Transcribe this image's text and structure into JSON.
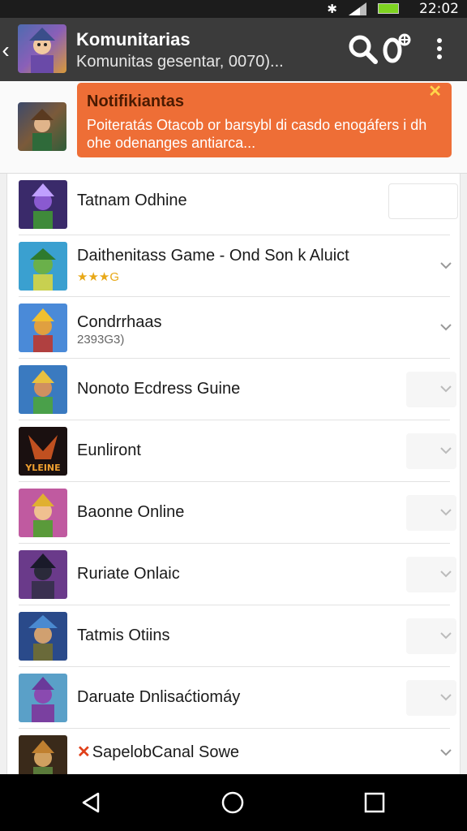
{
  "status": {
    "time": "22:02"
  },
  "app_bar": {
    "title": "Komunitarias",
    "subtitle": "Komunitas gesentar, 0070)...",
    "icons": [
      "back-arrow-icon",
      "search-icon",
      "settings-gear-icon",
      "more-vert-icon"
    ]
  },
  "notification": {
    "title": "Notifikiantas",
    "body": "Poiteratás Otacob or barsybl di casdo enogáfers i dh ohe odenanges antiarca..."
  },
  "games": [
    {
      "name": "Tatnam Odhine",
      "sub": "",
      "control": "button"
    },
    {
      "name": "Daithenitass Game - Ond Son k Aluict",
      "sub": "★★★G",
      "sub_type": "stars",
      "control": "chevron"
    },
    {
      "name": "Condrrhaas",
      "sub": "2393G3)",
      "sub_type": "text",
      "control": "chevron"
    },
    {
      "name": "Nonoto Ecdress Guine",
      "sub": "",
      "control": "chevron"
    },
    {
      "name": "Eunliront",
      "sub": "",
      "control": "chevron"
    },
    {
      "name": "Baonne Online",
      "sub": "",
      "control": "chevron"
    },
    {
      "name": "Ruriate Onlaic",
      "sub": "",
      "control": "chevron"
    },
    {
      "name": "Tatmis Otiins",
      "sub": "",
      "control": "chevron"
    },
    {
      "name": "Daruate Dnlisaćtiomáy",
      "sub": "",
      "control": "chevron"
    },
    {
      "name": "SapelobCanal Sowe",
      "sub": "",
      "control": "chevron",
      "prefix": "✕"
    }
  ],
  "thumb_logo_text": "YLEINE",
  "colors": {
    "toolbar": "#3b3b3b",
    "toast": "#ee6e36",
    "stars": "#e8a817"
  }
}
